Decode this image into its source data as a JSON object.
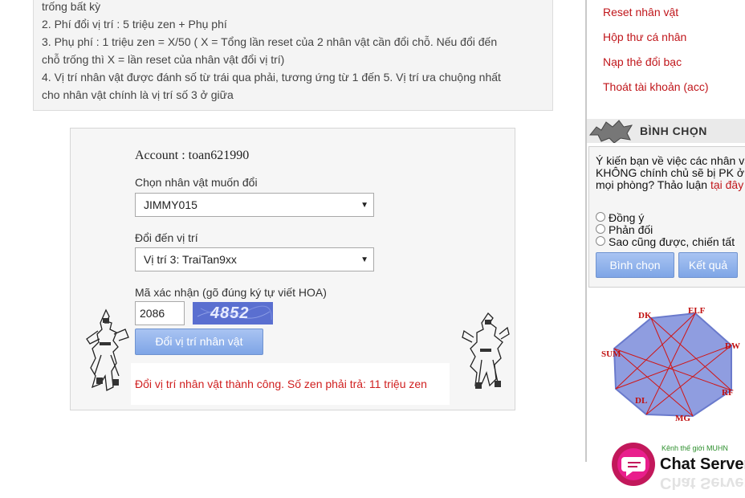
{
  "info": {
    "lines": [
      "trống bất kỳ",
      "2. Phí đổi vị trí : 5 triệu zen + Phụ phí",
      "3. Phụ phí : 1 triệu zen = X/50 ( X = Tổng lần reset của 2 nhân vật cần đổi chỗ. Nếu đổi đến",
      "chỗ trống thì X = lần reset của nhân vật đổi vị trí)",
      "4. Vị trí nhân vật được đánh số từ trái qua phải, tương ứng từ 1 đến 5. Vị trí ưa chuộng nhất",
      "cho nhân vật chính là vị trí số 3 ở giữa"
    ]
  },
  "form": {
    "account_label": "Account : toan621990",
    "choose_label": "Chọn nhân vật muốn đổi",
    "choose_value": "JIMMY015",
    "target_label": "Đổi đến vị trí",
    "target_value": "Vị trí 3: TraiTan9xx",
    "captcha_label": "Mã xác nhận (gõ đúng ký tự viết HOA)",
    "captcha_input": "2086",
    "captcha_image_text": "4852",
    "submit_label": "Đổi vị trí nhân vật",
    "result": "Đổi vị trí nhân vật thành công. Số zen phải trả: 11 triệu zen"
  },
  "sidebar": {
    "menu": [
      "Reset nhân vật",
      "Hộp thư cá nhân",
      "Nạp thẻ đổi bạc",
      "Thoát tài khoản (acc)"
    ],
    "vote": {
      "title": "BÌNH CHỌN",
      "question": "Ý kiến bạn về việc các nhân vật KHÔNG chính chủ sẽ bị PK ở mọi phòng? Thảo luận",
      "link": "tại đây",
      "options": [
        "Đồng ý",
        "Phản đối",
        "Sao cũng được, chiến tất"
      ],
      "vote_button": "Bình chọn",
      "results_button": "Kết quả"
    },
    "classes": [
      "DK",
      "ELF",
      "DW",
      "RF",
      "MG",
      "DL",
      "SUM"
    ],
    "promo": {
      "tagline": "Kênh thế giới MUHN",
      "title": "Chat Server"
    }
  },
  "colors": {
    "link_red": "#c0161b",
    "button_blue": "#7ea5e6",
    "result_red": "#d02020"
  }
}
